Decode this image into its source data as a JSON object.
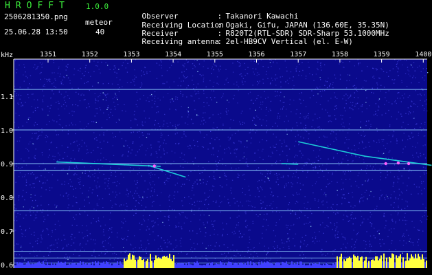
{
  "header": {
    "app_title": "HROFFT",
    "app_version": "1.0.0",
    "file_name": "2506281350.png",
    "capture_time": "25.06.28 13:50",
    "meteor_label": "meteor",
    "meteor_count": "40",
    "info": [
      {
        "key": "Observer",
        "value": "Takanori Kawachi"
      },
      {
        "key": "Receiving Location",
        "value": "Ogaki, Gifu, JAPAN (136.60E, 35.35N)"
      },
      {
        "key": "Receiver",
        "value": "R820T2(RTL-SDR) SDR-Sharp 53.1000MHz"
      },
      {
        "key": "Receiving antenna",
        "value": "2el-HB9CV Vertical (el. E-W)"
      }
    ]
  },
  "chart_data": {
    "type": "heatmap",
    "ylabel": "kHz",
    "x_ticks": [
      "1351",
      "1352",
      "1353",
      "1354",
      "1355",
      "1356",
      "1357",
      "1358",
      "1359",
      "1400"
    ],
    "y_ticks": [
      "1.1",
      "1.0",
      "0.9",
      "0.8",
      "0.7",
      "0.6"
    ],
    "ylim": [
      0.59,
      1.21
    ],
    "colors": {
      "background": "#0a0a8c",
      "noise": "#3a3ad8",
      "line": "#8fd0ff",
      "signal": "#20e0e0",
      "hot": "#ff60ff",
      "bar_low": "#4040ff",
      "bar_high": "#ffff40",
      "axis": "#ffffff"
    },
    "horizontal_lines_khz": [
      1.12,
      1.0,
      0.9,
      0.88,
      0.76,
      0.64,
      0.62,
      0.605
    ],
    "meteor_traces": [
      {
        "t": [
          1351.2,
          1353.7
        ],
        "f": [
          0.905,
          0.892
        ]
      },
      {
        "t": [
          1353.4,
          1354.3
        ],
        "f": [
          0.895,
          0.86
        ]
      },
      {
        "t": [
          1356.6,
          1357.0
        ],
        "f": [
          0.9,
          0.898
        ]
      },
      {
        "t": [
          1357.0,
          1358.6
        ],
        "f": [
          0.965,
          0.922
        ]
      },
      {
        "t": [
          1358.6,
          1400.2
        ],
        "f": [
          0.922,
          0.895
        ]
      }
    ]
  }
}
